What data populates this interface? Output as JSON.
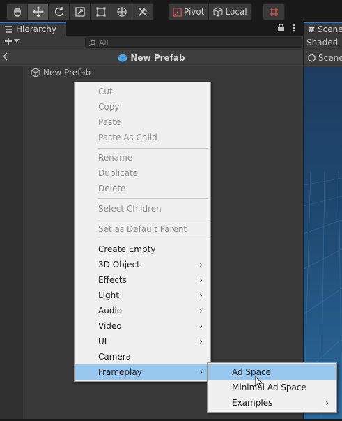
{
  "toolbar": {
    "pivot_label": "Pivot",
    "local_label": "Local"
  },
  "hierarchy": {
    "tab_label": "Hierarchy",
    "search_placeholder": "All",
    "prefab_header": "New Prefab",
    "tree_item": "New Prefab"
  },
  "scene": {
    "tab_label": "Scene",
    "shaded_label": "Shaded",
    "subtab_label": "Scene"
  },
  "context_menu": {
    "cut": "Cut",
    "copy": "Copy",
    "paste": "Paste",
    "paste_as_child": "Paste As Child",
    "rename": "Rename",
    "duplicate": "Duplicate",
    "delete": "Delete",
    "select_children": "Select Children",
    "set_default_parent": "Set as Default Parent",
    "create_empty": "Create Empty",
    "object_3d": "3D Object",
    "effects": "Effects",
    "light": "Light",
    "audio": "Audio",
    "video": "Video",
    "ui": "UI",
    "camera": "Camera",
    "frameplay": "Frameplay"
  },
  "submenu": {
    "ad_space": "Ad Space",
    "minimal_ad_space": "Minimal Ad Space",
    "examples": "Examples"
  },
  "colors": {
    "menu_bg": "#f0f0f0",
    "menu_highlight": "#98c7f0",
    "panel_bg": "#383838",
    "accent": "#3a79bb"
  }
}
